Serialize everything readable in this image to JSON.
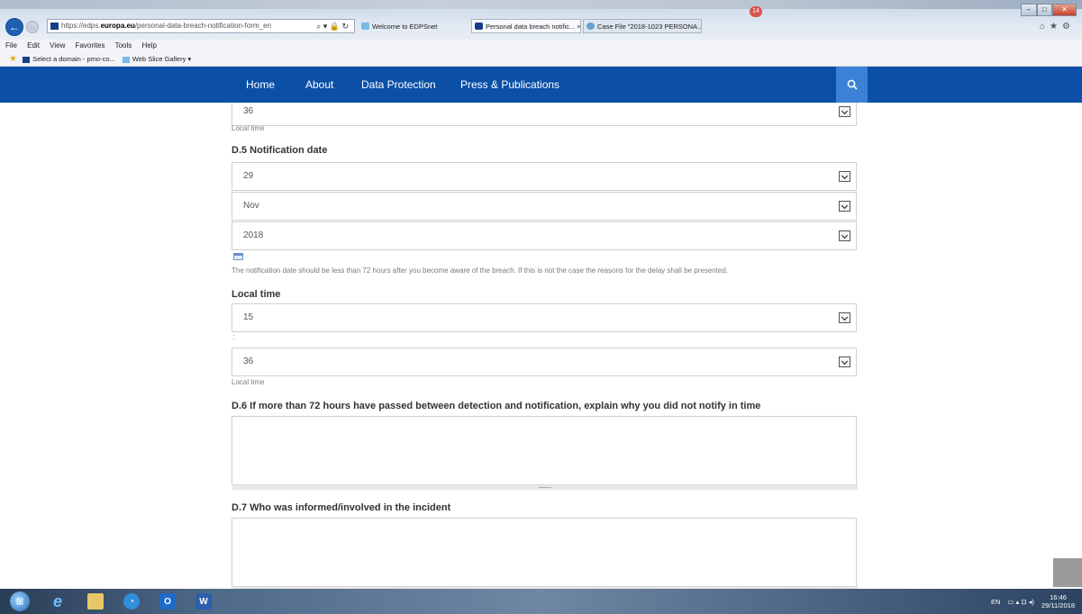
{
  "browser": {
    "url_prefix": "https://edps.",
    "url_domain": "europa.eu",
    "url_path": "/personal-data-breach-notification-form_en",
    "tabs": [
      {
        "label": "Welcome to EDPSnet"
      },
      {
        "label": "Personal data breach notific... ×"
      },
      {
        "label": "Case File \"2018-1023 PERSONA..."
      }
    ],
    "notification_count": "14",
    "menu": [
      "File",
      "Edit",
      "View",
      "Favorites",
      "Tools",
      "Help"
    ],
    "favorites": [
      {
        "label": "Select a domain - pmo-co..."
      },
      {
        "label": "Web Slice Gallery ▾"
      }
    ]
  },
  "site_nav": {
    "items": [
      "Home",
      "About",
      "Data Protection",
      "Press & Publications"
    ],
    "search_icon": "search-icon"
  },
  "form": {
    "prev_minute_value": "36",
    "prev_local_time_hint": "Local time",
    "d5_heading": "D.5 Notification date",
    "day_value": "29",
    "month_value": "Nov",
    "year_value": "2018",
    "notification_hint": "The notification date should be less than 72 hours after you become aware of the breach. If this is not the case the reasons for the delay shall be presented.",
    "local_time_heading": "Local time",
    "hour_value": "15",
    "colon": ":",
    "minute_value": "36",
    "local_time_hint": "Local time",
    "d6_heading": "D.6 If more than 72 hours have passed between detection and notification, explain why you did not notify in time",
    "d7_heading": "D.7 Who was informed/involved in the incident"
  },
  "taskbar": {
    "language": "EN",
    "time": "16:46",
    "date": "29/11/2018",
    "apps": [
      "start-icon",
      "internet-explorer-icon",
      "file-explorer-icon",
      "app-icon",
      "outlook-icon",
      "word-icon"
    ]
  },
  "colors": {
    "nav_blue": "#0b4fa6",
    "search_blue": "#3b82d6"
  }
}
